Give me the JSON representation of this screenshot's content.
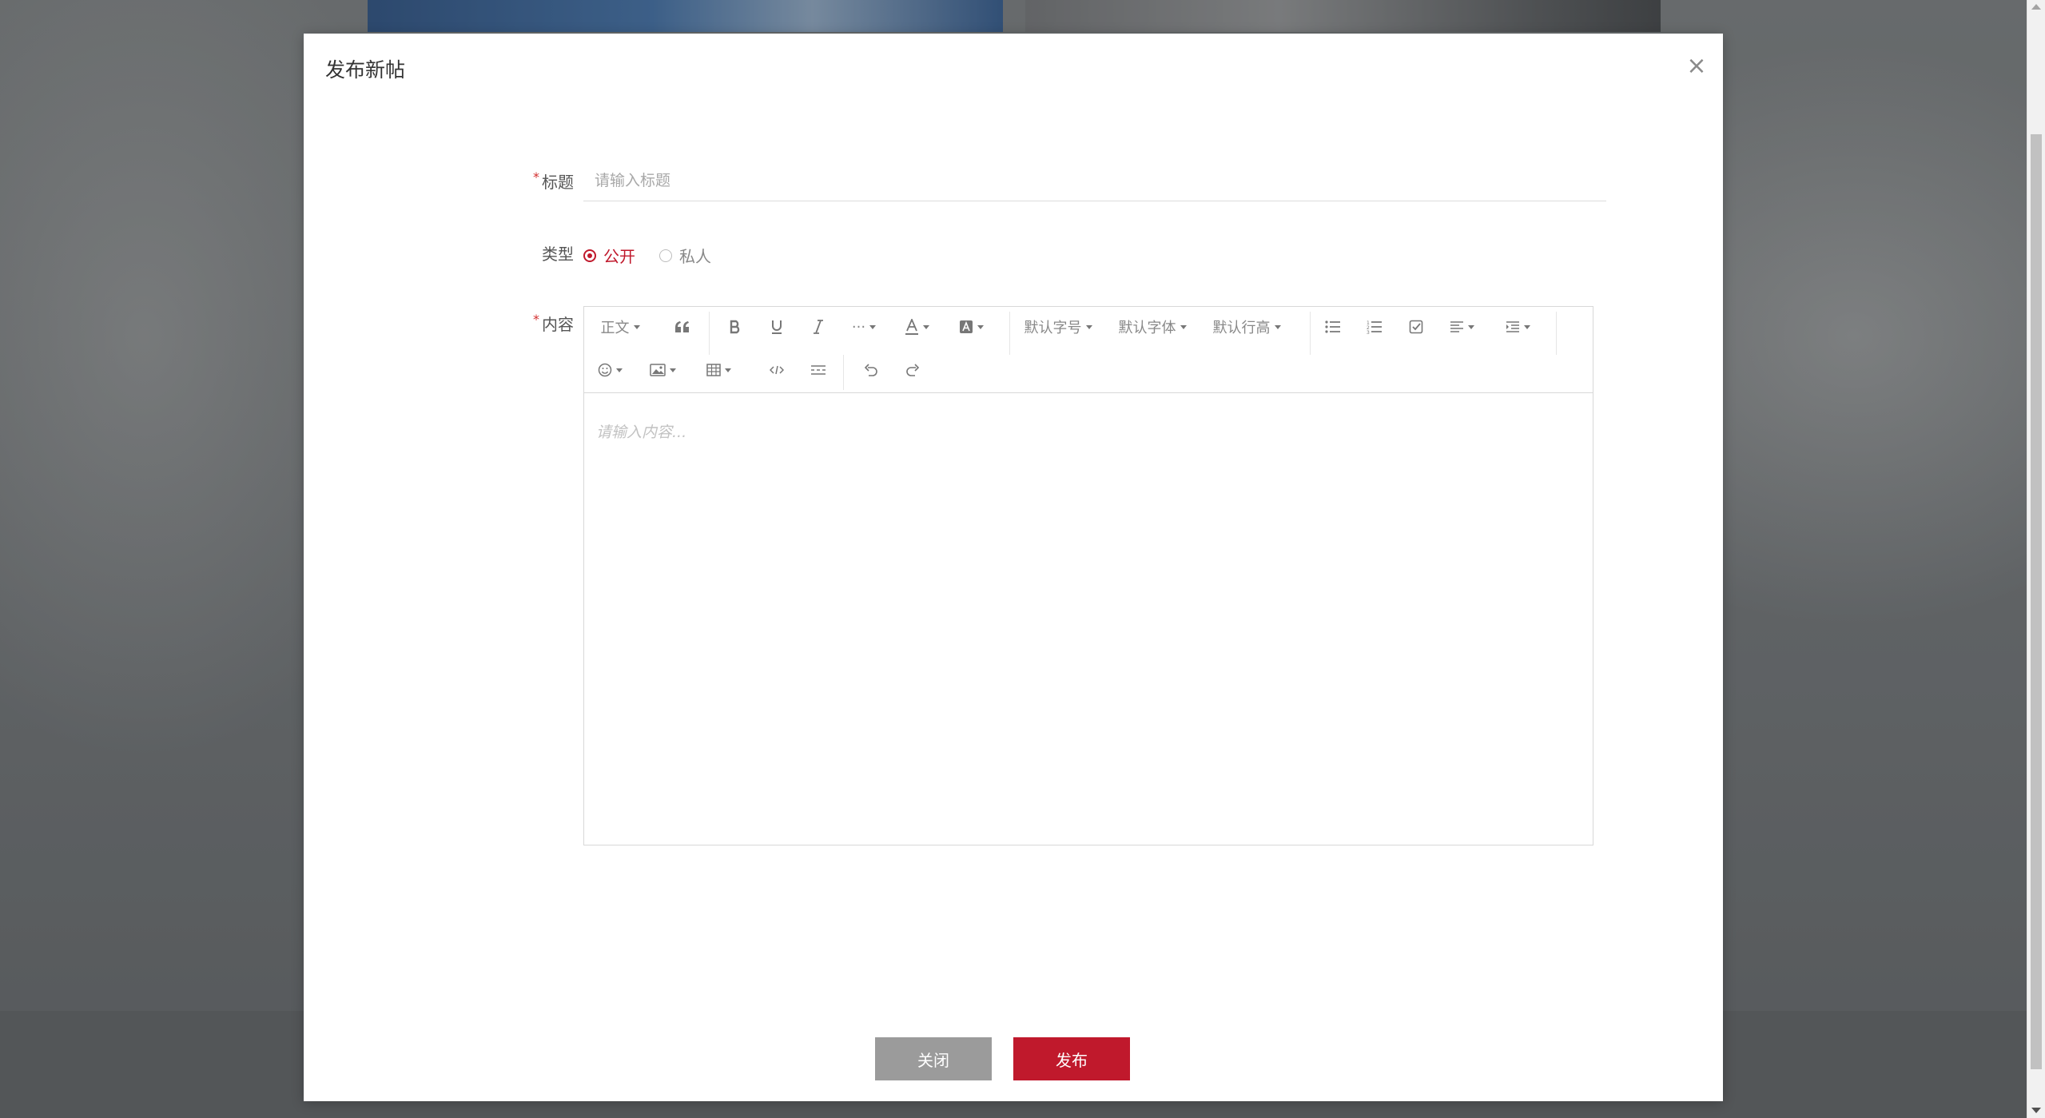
{
  "modal": {
    "title": "发布新帖",
    "close_symbol": "×"
  },
  "form": {
    "title_label": "标题",
    "title_placeholder": "请输入标题",
    "title_value": "",
    "type_label": "类型",
    "type_options": [
      {
        "label": "公开",
        "selected": true
      },
      {
        "label": "私人",
        "selected": false
      }
    ],
    "content_label": "内容",
    "required_mark": "*"
  },
  "editor": {
    "toolbar": {
      "paragraph": "正文",
      "font_size": "默认字号",
      "font_family": "默认字体",
      "line_height": "默认行高",
      "more": "···"
    },
    "placeholder": "请输入内容..."
  },
  "footer": {
    "close_label": "关闭",
    "publish_label": "发布"
  },
  "colors": {
    "accent": "#c0192c",
    "close_button": "#9b9b9b"
  }
}
